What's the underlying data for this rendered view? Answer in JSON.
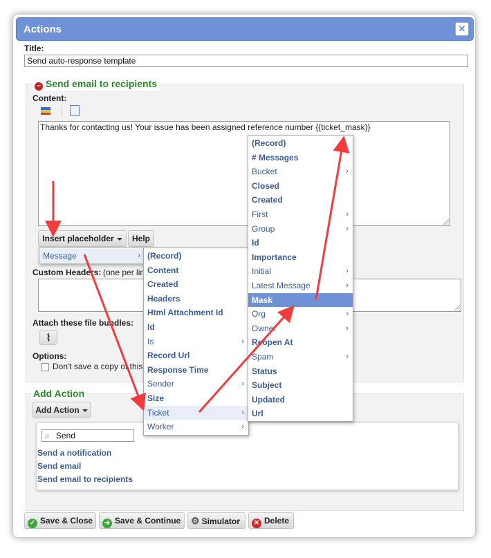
{
  "dialog": {
    "title": "Actions",
    "close_icon": "close-icon"
  },
  "form": {
    "title_label": "Title:",
    "title_value": "Send auto-response template",
    "section_title": "Send email to recipients",
    "content_label": "Content:",
    "content_value": "Thanks for contacting us!  Your issue has been assigned reference number {{ticket_mask}}",
    "insert_placeholder_button": "Insert placeholder",
    "help_button": "Help",
    "custom_headers_label": "Custom Headers:",
    "custom_headers_hint": "(one per line",
    "attach_label": "Attach these file bundles:",
    "options_label": "Options:",
    "dont_save_label": "Don't save a copy of this"
  },
  "add_action": {
    "section_title": "Add Action",
    "button": "Add Action",
    "search_value": "Send",
    "results": [
      "Send a notification",
      "Send email",
      "Send email to recipients"
    ]
  },
  "menu1": {
    "items": [
      {
        "label": "Message",
        "submenu": true
      }
    ]
  },
  "menu2": {
    "items": [
      {
        "label": "(Record)",
        "bold": true,
        "submenu": false
      },
      {
        "label": "Content",
        "bold": true,
        "submenu": false
      },
      {
        "label": "Created",
        "bold": true,
        "submenu": false
      },
      {
        "label": "Headers",
        "bold": true,
        "submenu": false
      },
      {
        "label": "Html Attachment Id",
        "bold": true,
        "submenu": false
      },
      {
        "label": "Id",
        "bold": true,
        "submenu": false
      },
      {
        "label": "Is",
        "bold": false,
        "submenu": true
      },
      {
        "label": "Record Url",
        "bold": true,
        "submenu": false
      },
      {
        "label": "Response Time",
        "bold": true,
        "submenu": false
      },
      {
        "label": "Sender",
        "bold": false,
        "submenu": true
      },
      {
        "label": "Size",
        "bold": true,
        "submenu": false
      },
      {
        "label": "Ticket",
        "bold": false,
        "submenu": true
      },
      {
        "label": "Worker",
        "bold": false,
        "submenu": true
      }
    ]
  },
  "menu3": {
    "items": [
      {
        "label": "(Record)",
        "bold": true,
        "submenu": false
      },
      {
        "label": "# Messages",
        "bold": true,
        "submenu": false
      },
      {
        "label": "Bucket",
        "bold": false,
        "submenu": true
      },
      {
        "label": "Closed",
        "bold": true,
        "submenu": false
      },
      {
        "label": "Created",
        "bold": true,
        "submenu": false
      },
      {
        "label": "First",
        "bold": false,
        "submenu": true
      },
      {
        "label": "Group",
        "bold": false,
        "submenu": true
      },
      {
        "label": "Id",
        "bold": true,
        "submenu": false
      },
      {
        "label": "Importance",
        "bold": true,
        "submenu": false
      },
      {
        "label": "Initial",
        "bold": false,
        "submenu": true
      },
      {
        "label": "Latest Message",
        "bold": false,
        "submenu": true
      },
      {
        "label": "Mask",
        "bold": true,
        "submenu": false
      },
      {
        "label": "Org",
        "bold": false,
        "submenu": true
      },
      {
        "label": "Owner",
        "bold": false,
        "submenu": true
      },
      {
        "label": "Reopen At",
        "bold": true,
        "submenu": false
      },
      {
        "label": "Spam",
        "bold": false,
        "submenu": true
      },
      {
        "label": "Status",
        "bold": true,
        "submenu": false
      },
      {
        "label": "Subject",
        "bold": true,
        "submenu": false
      },
      {
        "label": "Updated",
        "bold": true,
        "submenu": false
      },
      {
        "label": "Url",
        "bold": true,
        "submenu": false
      }
    ]
  },
  "footer": {
    "save_close": "Save & Close",
    "save_continue": "Save & Continue",
    "simulator": "Simulator",
    "delete": "Delete"
  },
  "colors": {
    "accent": "#6f92d6",
    "arrow": "#f03c3c",
    "section_title": "#2a8a2a",
    "link": "#3a5d8f"
  }
}
